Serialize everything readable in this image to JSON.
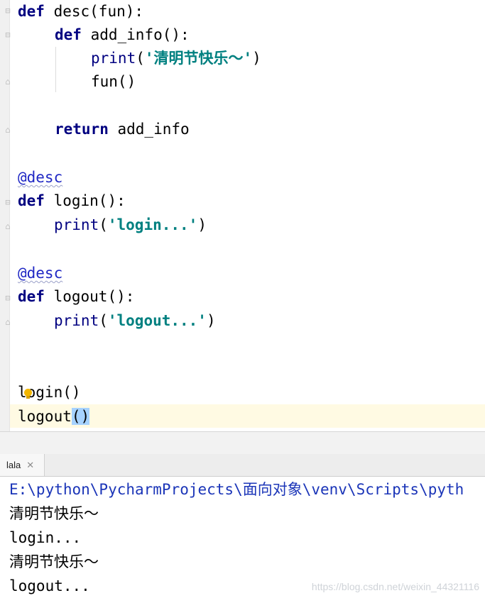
{
  "editor": {
    "lines": [
      {
        "kw": "def",
        "rest": " desc(fun):"
      },
      {
        "kw": "def",
        "rest": " add_info():"
      },
      {
        "builtin": "print",
        "open": "(",
        "string": "'清明节快乐～'",
        "close": ")"
      },
      {
        "text": "fun()"
      },
      {
        "kw": "return",
        "rest": " add_info"
      },
      {
        "decorator": "@desc"
      },
      {
        "kw": "def",
        "rest": " login():"
      },
      {
        "builtin": "print",
        "open": "(",
        "string": "'login...'",
        "close": ")"
      },
      {
        "decorator": "@desc"
      },
      {
        "kw": "def",
        "rest": " logout():"
      },
      {
        "builtin": "print",
        "open": "(",
        "string": "'logout...'",
        "close": ")"
      },
      {
        "text": "login()"
      },
      {
        "text": "logout",
        "selected": "()"
      }
    ]
  },
  "run_panel": {
    "tab_label": "lala",
    "output": [
      "E:\\python\\PycharmProjects\\面向对象\\venv\\Scripts\\pyth",
      "清明节快乐～",
      "login...",
      "清明节快乐～",
      "logout..."
    ]
  },
  "watermark": "https://blog.csdn.net/weixin_44321116",
  "colors": {
    "keyword": "#000080",
    "string": "#008080",
    "decorator": "#1f27c4",
    "caret_row": "#fffae3",
    "selection": "#a6d2ff"
  },
  "icons": [
    "fold-icon",
    "lightbulb-icon",
    "close-icon"
  ]
}
